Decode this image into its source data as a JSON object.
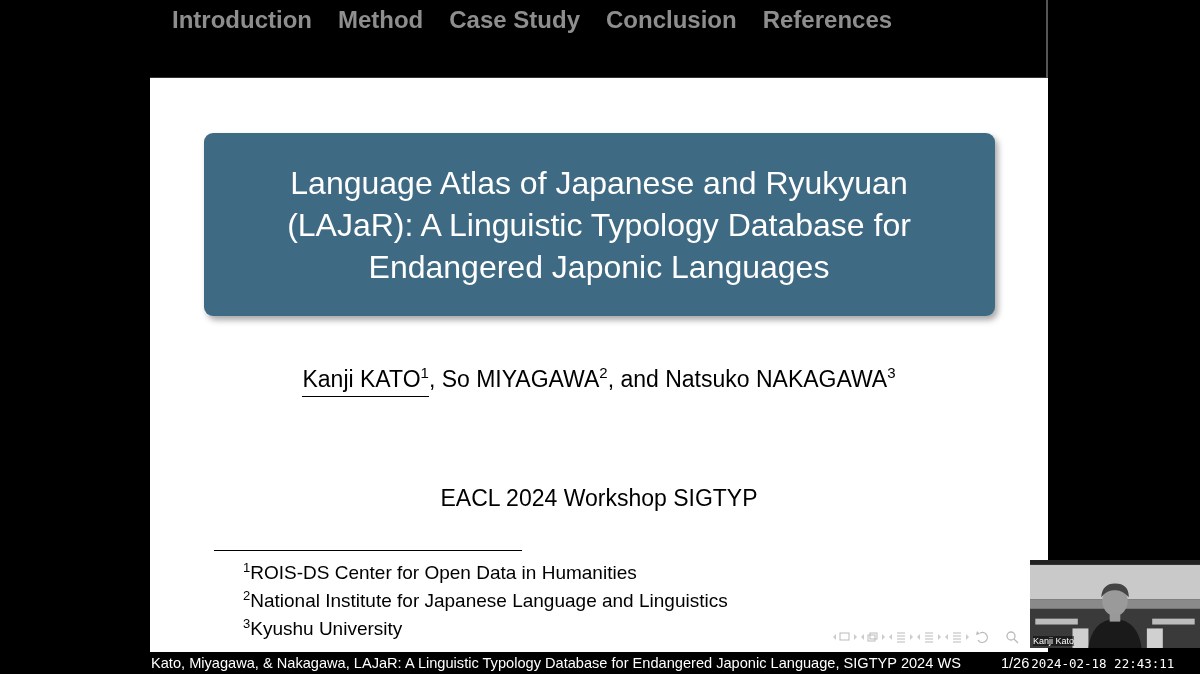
{
  "nav": {
    "items": [
      {
        "label": "Introduction"
      },
      {
        "label": "Method"
      },
      {
        "label": "Case Study"
      },
      {
        "label": "Conclusion"
      },
      {
        "label": "References"
      }
    ]
  },
  "slide": {
    "title": "Language Atlas of Japanese and Ryukyuan (LAJaR): A Linguistic Typology Database for Endangered Japonic Languages",
    "authors": [
      {
        "name": "Kanji KATO",
        "mark": "1",
        "underlined": true,
        "sep": ", "
      },
      {
        "name": "So MIYAGAWA",
        "mark": "2",
        "underlined": false,
        "sep": ", and "
      },
      {
        "name": "Natsuko NAKAGAWA",
        "mark": "3",
        "underlined": false
      }
    ],
    "venue": "EACL 2024 Workshop SIGTYP",
    "footnotes": [
      {
        "mark": "1",
        "text": "ROIS-DS Center for Open Data in Humanities"
      },
      {
        "mark": "2",
        "text": "National Institute for Japanese Language and Linguistics"
      },
      {
        "mark": "3",
        "text": "Kyushu University"
      }
    ]
  },
  "footer": {
    "citation": "Kato, Miyagawa, & Nakagawa, LAJaR: A Linguistic Typology Database for Endangered Japonic Language, SIGTYP 2024 WS",
    "page": "1/26",
    "timestamp": "2024-02-18 22:43:11"
  },
  "webcam": {
    "name": "Kanji Kato"
  }
}
